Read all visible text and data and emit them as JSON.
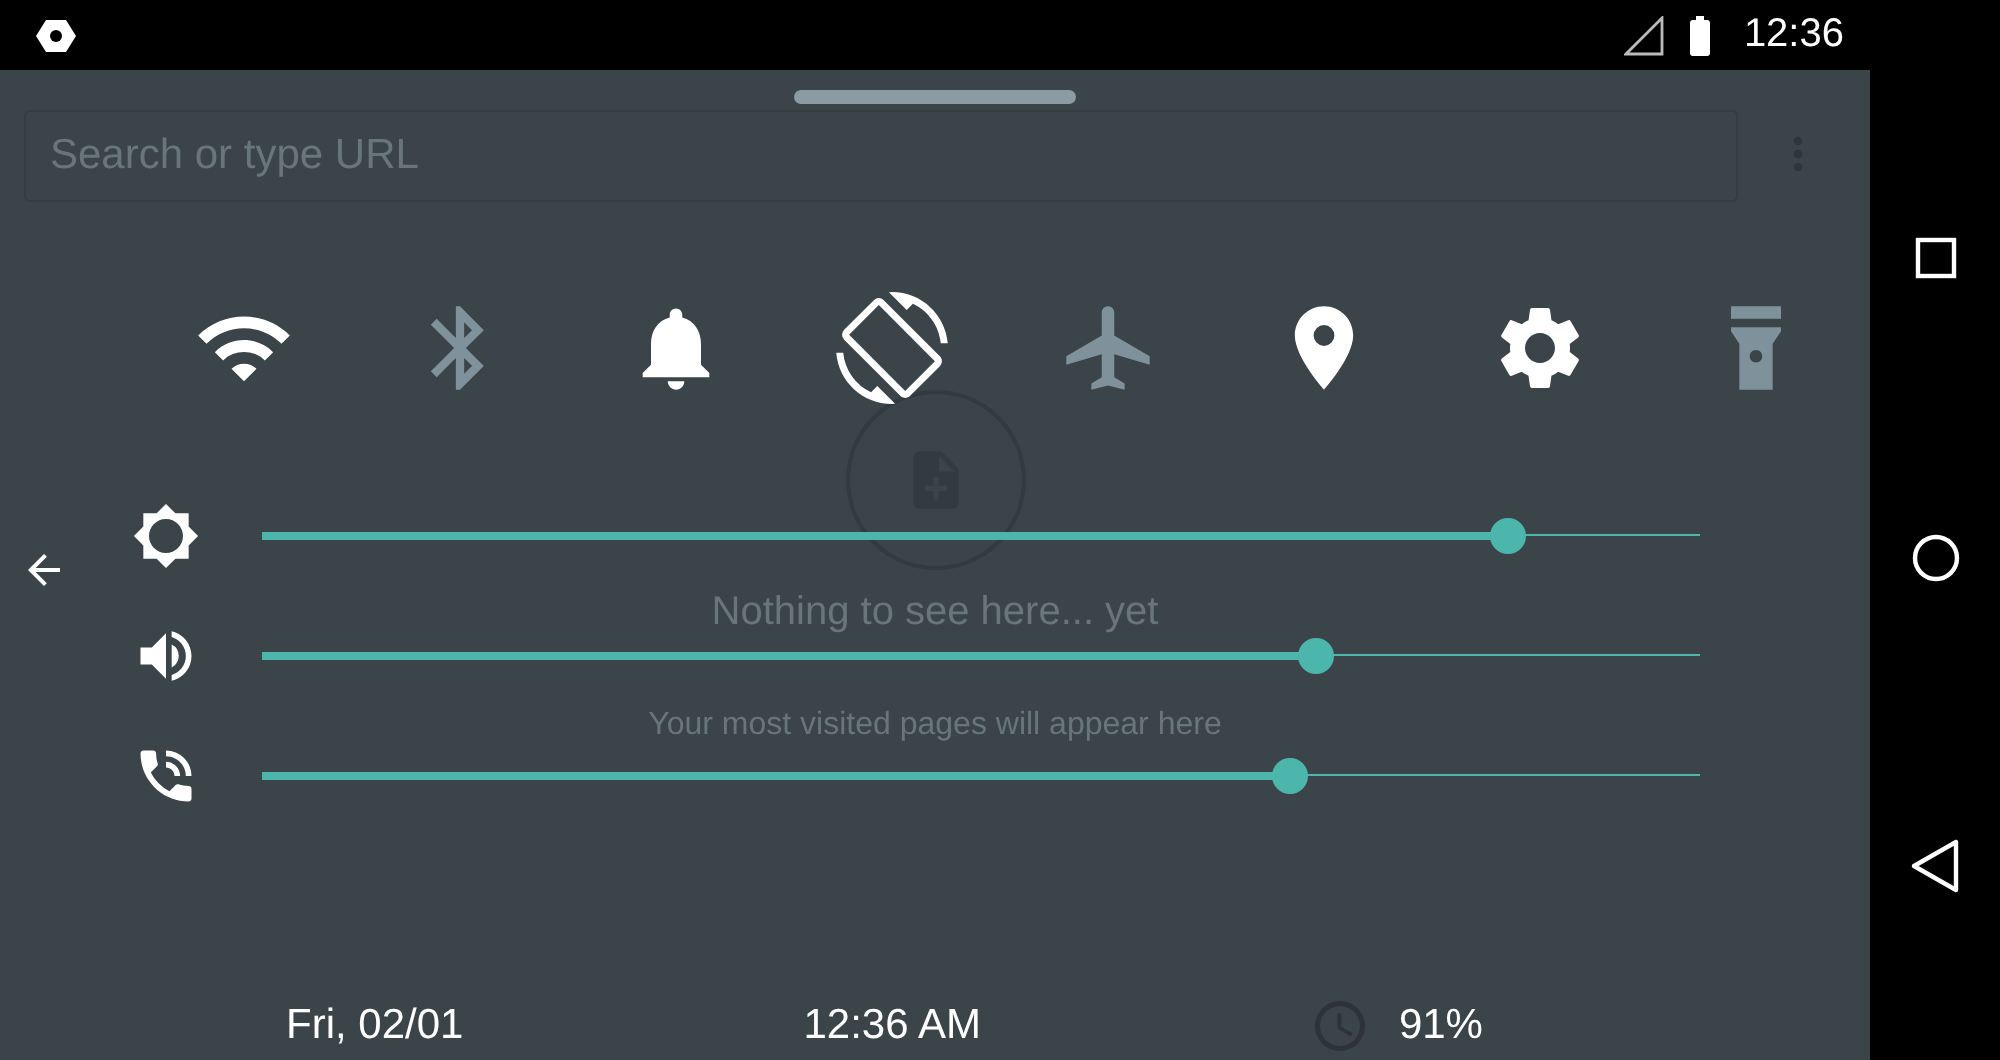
{
  "status_bar": {
    "time": "12:36"
  },
  "background_page": {
    "search_field": {
      "placeholder": "Search or type URL"
    },
    "empty_state": {
      "title": "Nothing to see here... yet",
      "subtitle": "Your most visited pages will appear here"
    }
  },
  "toggles": [
    {
      "on": true
    },
    {
      "on": false
    },
    {
      "on": true
    },
    {
      "on": true
    },
    {
      "on": false
    },
    {
      "on": true
    },
    {
      "on": true
    },
    {
      "on": false
    }
  ],
  "sliders": [
    {
      "level": 0.866
    },
    {
      "level": 0.733
    },
    {
      "level": 0.715
    }
  ],
  "footer": {
    "date": "Fri, 02/01",
    "time": "12:36 AM",
    "battery": "91%"
  }
}
